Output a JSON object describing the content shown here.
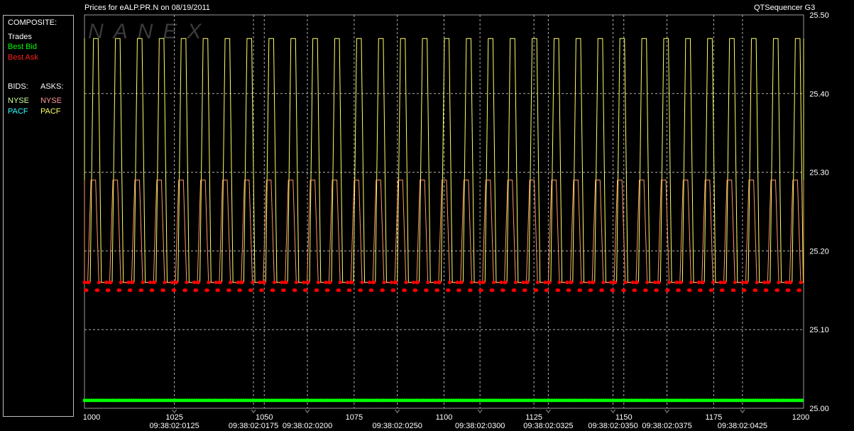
{
  "window": {
    "title": "Prices for  eALP.PR.N  on  08/19/2011",
    "app_name": "QTSequencer G3",
    "watermark": "NANEX"
  },
  "legend": {
    "composite_header": "COMPOSITE:",
    "composite_items": [
      {
        "label": "Trades",
        "color": "#ffffff"
      },
      {
        "label": "Best Bid",
        "color": "#00ff00"
      },
      {
        "label": "Best Ask",
        "color": "#ff2020"
      }
    ],
    "bids_header": "BIDS:",
    "asks_header": "ASKS:",
    "bids": [
      {
        "label": "NYSE",
        "color": "#ccff99"
      },
      {
        "label": "PACF",
        "color": "#33ffff"
      }
    ],
    "asks": [
      {
        "label": "NYSE",
        "color": "#ff9999"
      },
      {
        "label": "PACF",
        "color": "#ffff66"
      }
    ]
  },
  "colors": {
    "background": "#000000",
    "gridline": "#b0b0b0",
    "axis_text": "#ffffff",
    "nyse_ask": "#ffff66",
    "pacf_ask": "#ff9966",
    "best_bid": "#00ff00",
    "best_ask": "#ff0000"
  },
  "chart_data": {
    "type": "line",
    "title": "Prices for  eALP.PR.N  on  08/19/2011",
    "x_range": [
      1000,
      1200
    ],
    "y_range": [
      25.0,
      25.5
    ],
    "x_ticks": [
      "1000",
      "1025",
      "1050",
      "1075",
      "1100",
      "1125",
      "1150",
      "1175",
      "1200"
    ],
    "y_ticks": [
      "25.50",
      "25.40",
      "25.30",
      "25.20",
      "25.10",
      "25.00"
    ],
    "time_labels": [
      {
        "seq": 1025,
        "label": "09:38:02:0125"
      },
      {
        "seq": 1047,
        "label": "09:38:02:0175"
      },
      {
        "seq": 1062,
        "label": "09:38:02:0200"
      },
      {
        "seq": 1087,
        "label": "09:38:02:0250"
      },
      {
        "seq": 1110,
        "label": "09:38:02:0300"
      },
      {
        "seq": 1129,
        "label": "09:38:02:0325"
      },
      {
        "seq": 1147,
        "label": "09:38:02:0350"
      },
      {
        "seq": 1162,
        "label": "09:38:02:0375"
      },
      {
        "seq": 1183,
        "label": "09:38:02:0425"
      }
    ],
    "grid": true,
    "series": [
      {
        "name": "NYSE",
        "side": "ask",
        "color": "#ffff66",
        "low": 25.16,
        "high": 25.47,
        "cycle_sequences": 6.1,
        "phase_sequences": 1.6
      },
      {
        "name": "PACF",
        "side": "ask",
        "color": "#ff9966",
        "low": 25.16,
        "high": 25.29,
        "cycle_sequences": 6.1,
        "phase_sequences": 0.9
      },
      {
        "name": "Best Ask",
        "color": "#ff0000",
        "markers": "dots",
        "values_low": 25.15,
        "values_high": 25.16
      },
      {
        "name": "Best Bid",
        "color": "#00ff00",
        "markers": "dots",
        "value": 25.01
      }
    ]
  }
}
